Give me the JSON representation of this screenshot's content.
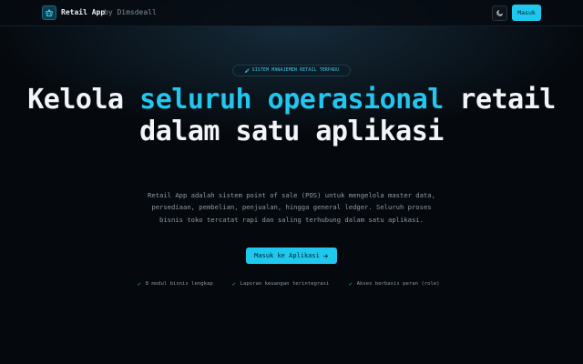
{
  "header": {
    "logo_icon": "shopping-basket-icon",
    "brand_name": "Retail App",
    "brand_by": "by Dimsdeall",
    "theme_toggle_icon": "moon-icon",
    "login_label": "Masuk"
  },
  "hero": {
    "badge_icon": "rocket-icon",
    "badge_text": "SISTEM MANAJEMEN RETAIL TERPADU",
    "title_part1": "Kelola ",
    "title_accent": "seluruh operasional",
    "title_part2": " retail dalam satu aplikasi",
    "description": "Retail App adalah sistem point of sale (POS) untuk mengelola master data, persediaan, pembelian, penjualan, hingga general ledger. Seluruh proses bisnis toko tercatat rapi dan saling terhubung dalam satu aplikasi.",
    "cta_label": "Masuk ke Aplikasi",
    "cta_icon": "arrow-right-icon"
  },
  "features": [
    {
      "icon": "check-icon",
      "label": "8 modul bisnis lengkap"
    },
    {
      "icon": "check-icon",
      "label": "Laporan keuangan terintegrasi"
    },
    {
      "icon": "check-icon",
      "label": "Akses berbasis peran (role)"
    }
  ],
  "colors": {
    "background": "#05090e",
    "accent": "#22c6ef",
    "button": "#1ec8ee",
    "text": "#f2f5f8",
    "muted": "#8e9aa6"
  }
}
